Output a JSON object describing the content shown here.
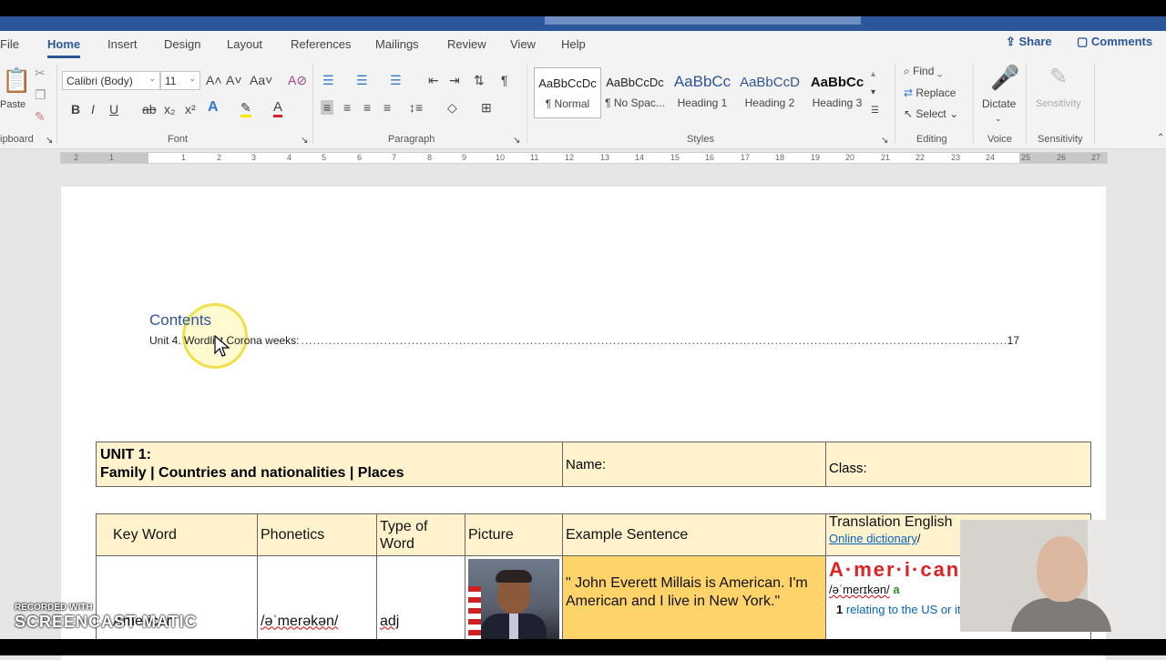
{
  "tabs": [
    "File",
    "Home",
    "Insert",
    "Design",
    "Layout",
    "References",
    "Mailings",
    "Review",
    "View",
    "Help"
  ],
  "active_tab": "Home",
  "share_label": "Share",
  "comments_label": "Comments",
  "clipboard": {
    "paste": "Paste",
    "group": "ipboard"
  },
  "font": {
    "name": "Calibri (Body)",
    "size": "11",
    "group": "Font"
  },
  "paragraph": {
    "group": "Paragraph"
  },
  "styles": {
    "group": "Styles",
    "items": [
      {
        "sample": "AaBbCcDc",
        "name": "¶ Normal"
      },
      {
        "sample": "AaBbCcDc",
        "name": "¶ No Spac..."
      },
      {
        "sample": "AaBbCc",
        "name": "Heading 1"
      },
      {
        "sample": "AaBbCcD",
        "name": "Heading 2"
      },
      {
        "sample": "AaBbCc",
        "name": "Heading 3"
      }
    ]
  },
  "editing": {
    "find": "Find",
    "replace": "Replace",
    "select": "Select",
    "group": "Editing"
  },
  "voice": {
    "dictate": "Dictate",
    "group": "Voice"
  },
  "sensitivity": {
    "label": "Sensitivity",
    "group": "Sensitivity"
  },
  "ruler_ticks": [
    "2",
    "1",
    "1",
    "2",
    "3",
    "4",
    "5",
    "6",
    "7",
    "8",
    "9",
    "10",
    "11",
    "12",
    "13",
    "14",
    "15",
    "16",
    "17",
    "18",
    "19",
    "20",
    "21",
    "22",
    "23",
    "24",
    "25",
    "26",
    "27"
  ],
  "document": {
    "toc_title": "Contents",
    "toc_entry": "Unit 4. Wordlist Corona weeks:",
    "toc_page": "17",
    "unit_title": "UNIT 1:",
    "unit_subtitle": "Family | Countries and nationalities | Places",
    "name_label": "Name:",
    "class_label": "Class:",
    "headers": [
      "Key Word",
      "Phonetics",
      "Type of Word",
      "Picture",
      "Example Sentence",
      "Translation English"
    ],
    "dictionary_link": "Online dictionary",
    "row": {
      "key_word": "American",
      "phonetics": "/əˈmerəkən/",
      "type": "adj",
      "sentence": "\" John Everett Millais is American. I'm American and I live in New York.\"",
      "dict_word": "A·mer·i·can",
      "dict_pron": "/əˈmerɪkən/",
      "dict_pos": "a",
      "dict_sense": "relating to the US or its people"
    }
  },
  "watermark": {
    "line1": "RECORDED WITH",
    "line2": "SCREENCAST MATIC"
  },
  "colors": {
    "accent": "#2b579a",
    "header_fill": "#fff2cc",
    "sentence_fill": "#fdd36a",
    "toc_title": "#2f5496"
  }
}
